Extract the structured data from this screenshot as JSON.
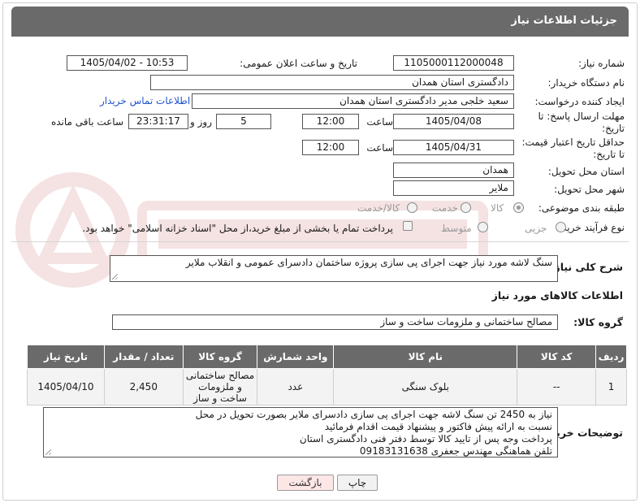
{
  "header": {
    "title": "جزئیات اطلاعات نیاز"
  },
  "fields": {
    "need_number_label": "شماره نیاز:",
    "need_number": "1105000112000048",
    "announce_label": "تاریخ و ساعت اعلان عمومی:",
    "announce_value": "1405/04/02 - 10:53",
    "buyer_org_label": "نام دستگاه خریدار:",
    "buyer_org": "دادگستری استان همدان",
    "creator_label": "ایجاد کننده درخواست:",
    "creator": "سعید خلجی مدیر دادگستری استان همدان",
    "contact_link": "اطلاعات تماس خریدار",
    "deadline_label_1": "مهلت ارسال پاسخ: تا",
    "deadline_label_2": "تاریخ:",
    "deadline_date": "1405/04/08",
    "time_label": "ساعت",
    "deadline_time": "12:00",
    "days_value": "5",
    "days_label": "روز و",
    "remaining_time": "23:31:17",
    "remaining_label": "ساعت باقی مانده",
    "validity_label_1": "حداقل تاریخ اعتبار قیمت:",
    "validity_label_2": "تا تاریخ:",
    "validity_date": "1405/04/31",
    "validity_time_label": "ساعت",
    "validity_time": "12:00",
    "province_label": "استان محل تحویل:",
    "province": "همدان",
    "city_label": "شهر محل تحویل:",
    "city": "ملایر",
    "category_label": "طبقه بندی موضوعی:",
    "category_options": [
      "کالا",
      "خدمت",
      "کالا/خدمت"
    ],
    "process_label": "نوع فرآیند خرید :",
    "process_options": [
      "جزیی",
      "متوسط"
    ],
    "payment_note": "پرداخت تمام یا بخشی از مبلغ خرید،از محل \"اسناد خزانه اسلامی\" خواهد بود."
  },
  "summary": {
    "label": "شرح کلی نیاز:",
    "text": "سنگ لاشه مورد نیاز جهت اجرای پی سازی پروژه ساختمان دادسرای عمومی و انقلاب ملایر"
  },
  "goods": {
    "section_title": "اطلاعات کالاهای مورد نیاز",
    "group_label": "گروه کالا:",
    "group_value": "مصالح ساختمانی و ملزومات ساخت و ساز"
  },
  "table": {
    "headers": [
      "ردیف",
      "کد کالا",
      "نام کالا",
      "واحد شمارش",
      "گروه کالا",
      "تعداد / مقدار",
      "تاریخ نیاز"
    ],
    "rows": [
      [
        "1",
        "--",
        "بلوک سنگی",
        "عدد",
        "مصالح ساختمانی و ملزومات ساخت و ساز",
        "2,450",
        "1405/04/10"
      ]
    ]
  },
  "buyer_notes": {
    "label": "توضیحات خریدار:",
    "lines": [
      "نیاز به 2450 تن سنگ لاشه جهت اجرای پی سازی دادسرای ملایر بصورت تحویل در محل",
      "نسبت به ارائه پیش فاکتور و پیشنهاد قیمت اقدام فرمائید",
      "پرداخت وجه پس از تایید کالا توسط دفتر فنی دادگستری استان",
      "تلفن هماهنگی مهندس جعفری 09183131638"
    ]
  },
  "buttons": {
    "print": "چاپ",
    "back": "بازگشت"
  },
  "colors": {
    "header_bg": "#6a6a6a",
    "link": "#2255cc",
    "back_button_bg": "#fde6e6"
  }
}
